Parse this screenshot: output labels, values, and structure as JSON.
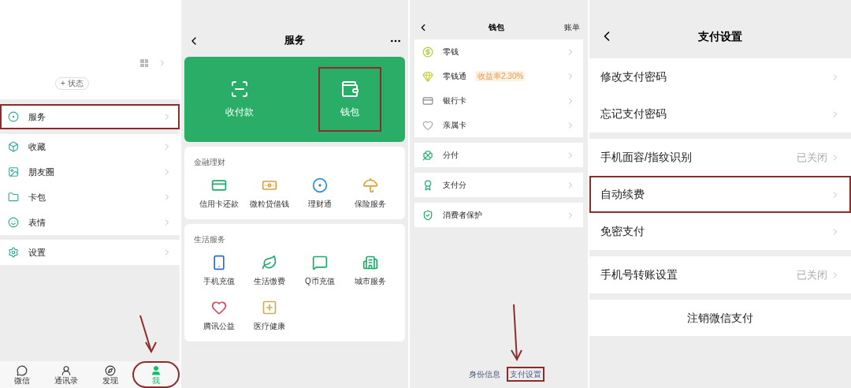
{
  "me": {
    "status_button": "+ 状态",
    "menu_groups": [
      [
        {
          "label": "服务",
          "highlighted": true
        }
      ],
      [
        {
          "label": "收藏",
          "highlighted": false
        },
        {
          "label": "朋友圈",
          "highlighted": false
        },
        {
          "label": "卡包",
          "highlighted": false
        },
        {
          "label": "表情",
          "highlighted": false
        }
      ],
      [
        {
          "label": "设置",
          "highlighted": false
        }
      ]
    ],
    "tabs": [
      {
        "label": "微信",
        "selected": false,
        "highlighted": false
      },
      {
        "label": "通讯录",
        "selected": false,
        "highlighted": false
      },
      {
        "label": "发现",
        "selected": false,
        "highlighted": false
      },
      {
        "label": "我",
        "selected": true,
        "highlighted": true
      }
    ]
  },
  "services": {
    "title": "服务",
    "hero": [
      {
        "label": "收付款",
        "highlighted": false
      },
      {
        "label": "钱包",
        "highlighted": true
      }
    ],
    "sections": [
      {
        "title": "金融理财",
        "items": [
          "信用卡还款",
          "微粒贷借钱",
          "理财通",
          "保险服务"
        ]
      },
      {
        "title": "生活服务",
        "items": [
          "手机充值",
          "生活缴费",
          "Q币充值",
          "城市服务",
          "腾讯公益",
          "医疗健康"
        ]
      }
    ]
  },
  "wallet": {
    "title": "钱包",
    "action": "账单",
    "groups": [
      [
        {
          "label": "零钱"
        },
        {
          "label": "零钱通",
          "badge": "收益率2.30%"
        },
        {
          "label": "银行卡"
        },
        {
          "label": "亲属卡"
        }
      ],
      [
        {
          "label": "分付"
        }
      ],
      [
        {
          "label": "支付分"
        }
      ],
      [
        {
          "label": "消费者保护"
        }
      ]
    ],
    "footer_links": [
      {
        "label": "身份信息",
        "highlighted": false
      },
      {
        "label": "支付设置",
        "highlighted": true
      }
    ]
  },
  "pay_settings": {
    "title": "支付设置",
    "groups": [
      [
        {
          "label": "修改支付密码",
          "highlighted": false
        },
        {
          "label": "忘记支付密码",
          "highlighted": false
        }
      ],
      [
        {
          "label": "手机面容/指纹识别",
          "value": "已关闭",
          "highlighted": false
        },
        {
          "label": "自动续费",
          "highlighted": true
        },
        {
          "label": "免密支付",
          "highlighted": false
        }
      ],
      [
        {
          "label": "手机号转账设置",
          "value": "已关闭",
          "highlighted": false
        }
      ]
    ],
    "deregister": "注销微信支付"
  }
}
